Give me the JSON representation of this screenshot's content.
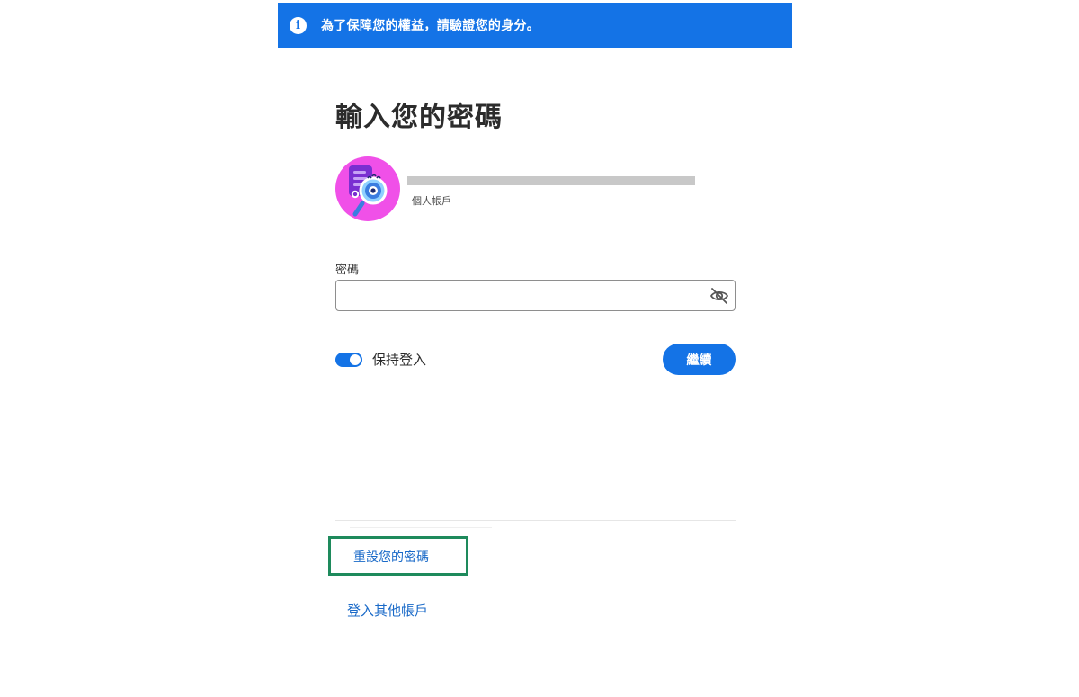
{
  "banner": {
    "icon": "info-icon",
    "text": "為了保障您的權益，請驗證您的身分。",
    "background": "#1473e6"
  },
  "page": {
    "title": "輸入您的密碼"
  },
  "account": {
    "avatar_icon": "document-search-avatar-icon",
    "account_type": "個人帳戶"
  },
  "password": {
    "label": "密碼",
    "value": "",
    "toggle_icon": "eye-slash-icon"
  },
  "stay_signed_in": {
    "label": "保持登入",
    "checked": true
  },
  "continue_button": {
    "label": "繼續"
  },
  "links": {
    "reset_password": "重設您的密碼",
    "other_account": "登入其他帳戶"
  },
  "colors": {
    "accent": "#1473e6",
    "link": "#1a6ac8",
    "highlight": "#1e8a5c"
  }
}
